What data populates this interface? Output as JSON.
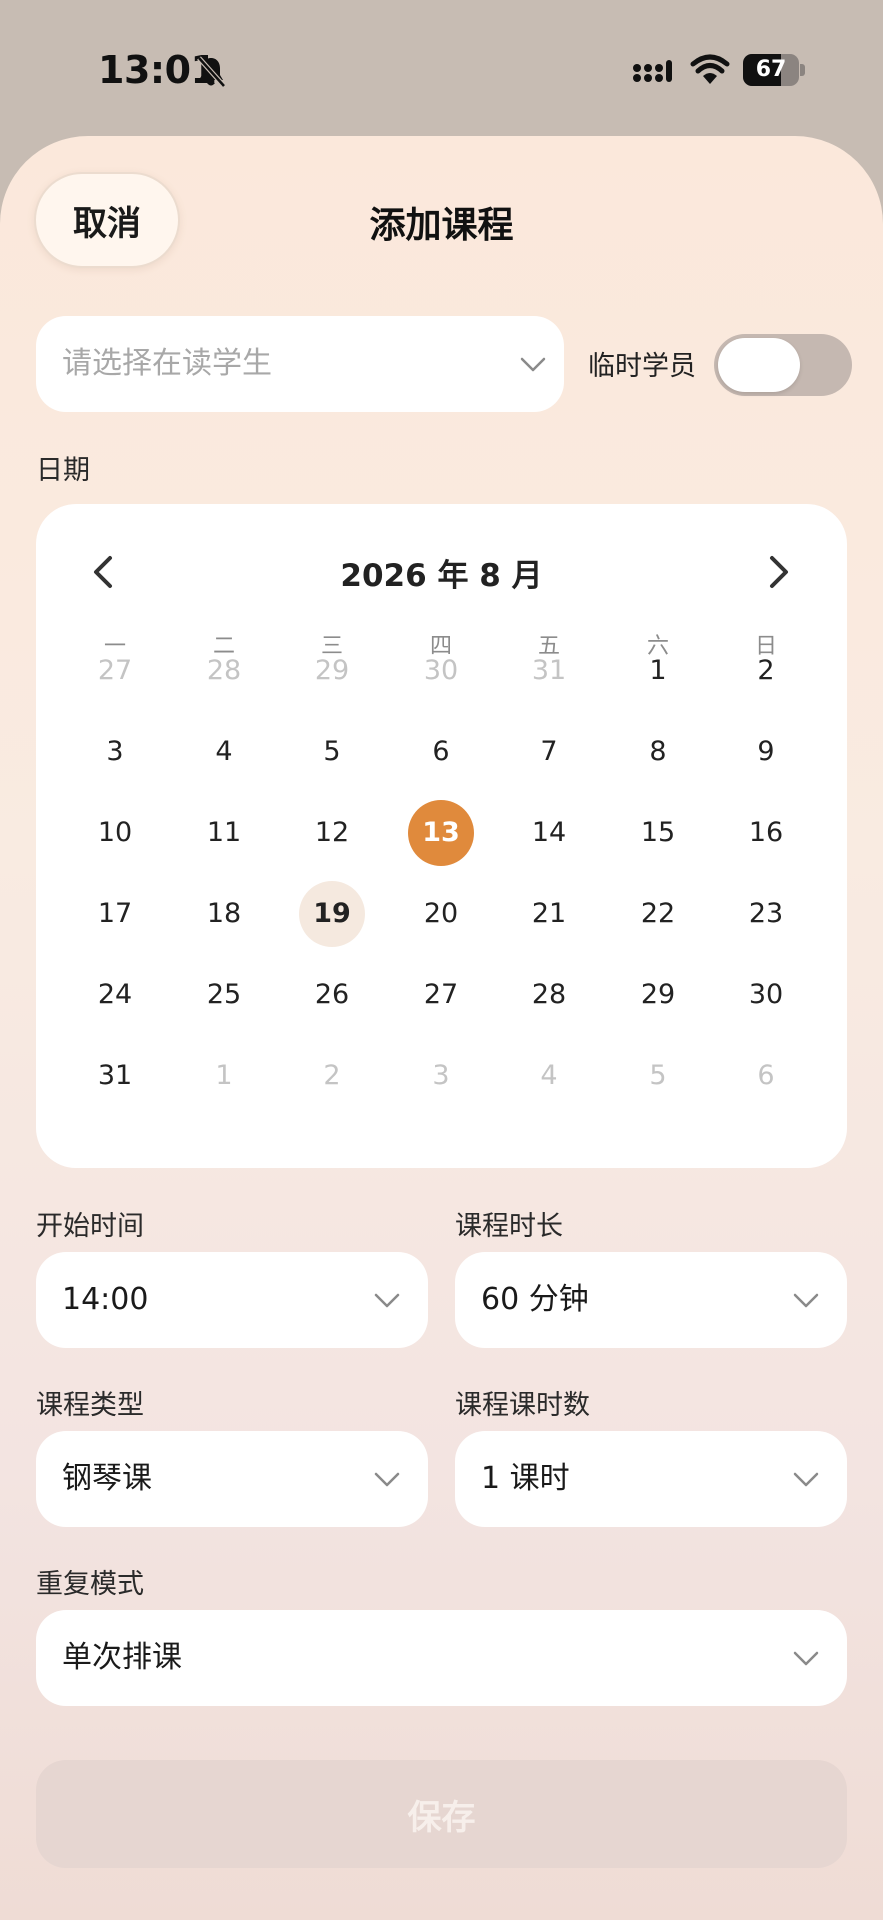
{
  "status_bar": {
    "time": "13:01",
    "battery_level": "67",
    "icons": [
      "bell-muted-icon",
      "cellular-signal-icon",
      "wifi-icon",
      "battery-icon"
    ]
  },
  "header": {
    "cancel_label": "取消",
    "title": "添加课程"
  },
  "student": {
    "placeholder": "请选择在读学生",
    "temp_label": "临时学员",
    "temp_enabled": false
  },
  "date_label": "日期",
  "calendar": {
    "title": "2026 年 8 月",
    "weekdays": [
      "一",
      "二",
      "三",
      "四",
      "五",
      "六",
      "日"
    ],
    "weeks": [
      [
        "27",
        "28",
        "29",
        "30",
        "31",
        "1",
        "2"
      ],
      [
        "3",
        "4",
        "5",
        "6",
        "7",
        "8",
        "9"
      ],
      [
        "10",
        "11",
        "12",
        "13",
        "14",
        "15",
        "16"
      ],
      [
        "17",
        "18",
        "19",
        "20",
        "21",
        "22",
        "23"
      ],
      [
        "24",
        "25",
        "26",
        "27",
        "28",
        "29",
        "30"
      ],
      [
        "31",
        "1",
        "2",
        "3",
        "4",
        "5",
        "6"
      ]
    ],
    "selected_day": "13",
    "today_day": "19",
    "accent_color": "#e08a3c"
  },
  "fields": {
    "start_time": {
      "label": "开始时间",
      "value": "14:00"
    },
    "duration": {
      "label": "课程时长",
      "value": "60 分钟"
    },
    "course_type": {
      "label": "课程类型",
      "value": "钢琴课"
    },
    "lesson_hours": {
      "label": "课程课时数",
      "value": "1 课时"
    },
    "repeat": {
      "label": "重复模式",
      "value": "单次排课"
    }
  },
  "save_label": "保存"
}
